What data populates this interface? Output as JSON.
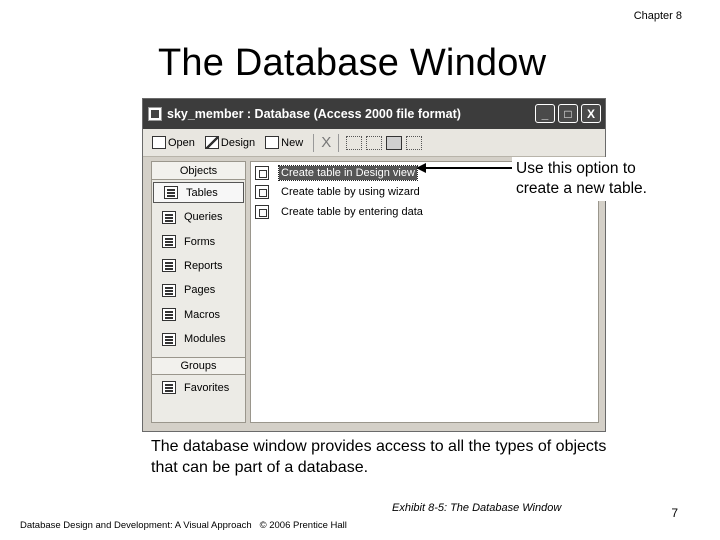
{
  "header": {
    "chapter": "Chapter 8",
    "title": "The Database Window"
  },
  "window": {
    "title": "sky_member : Database (Access 2000 file format)",
    "controls": [
      "_",
      "□",
      "X"
    ],
    "toolbar": {
      "open": "Open",
      "design": "Design",
      "new": "New",
      "delete": "X"
    },
    "objects_header": "Objects",
    "objects": [
      {
        "label": "Tables",
        "icon": "table-icon",
        "selected": true
      },
      {
        "label": "Queries",
        "icon": "query-icon"
      },
      {
        "label": "Forms",
        "icon": "form-icon"
      },
      {
        "label": "Reports",
        "icon": "report-icon"
      },
      {
        "label": "Pages",
        "icon": "page-icon"
      },
      {
        "label": "Macros",
        "icon": "macro-icon"
      },
      {
        "label": "Modules",
        "icon": "module-icon"
      }
    ],
    "groups_header": "Groups",
    "groups": [
      {
        "label": "Favorites",
        "icon": "favorites-icon"
      }
    ],
    "list_items": [
      {
        "label": "Create table in Design view",
        "selected": true
      },
      {
        "label": "Create table by using wizard"
      },
      {
        "label": "Create table by entering data"
      }
    ]
  },
  "callout": {
    "line1": "Use this option to",
    "line2": "create a new table."
  },
  "caption": "The database window provides access to all the types of objects that can be part of a database.",
  "exhibit": "Exhibit 8-5: The Database Window",
  "footer": "Database Design and Development: A Visual Approach   © 2006 Prentice Hall",
  "page_number": "7"
}
